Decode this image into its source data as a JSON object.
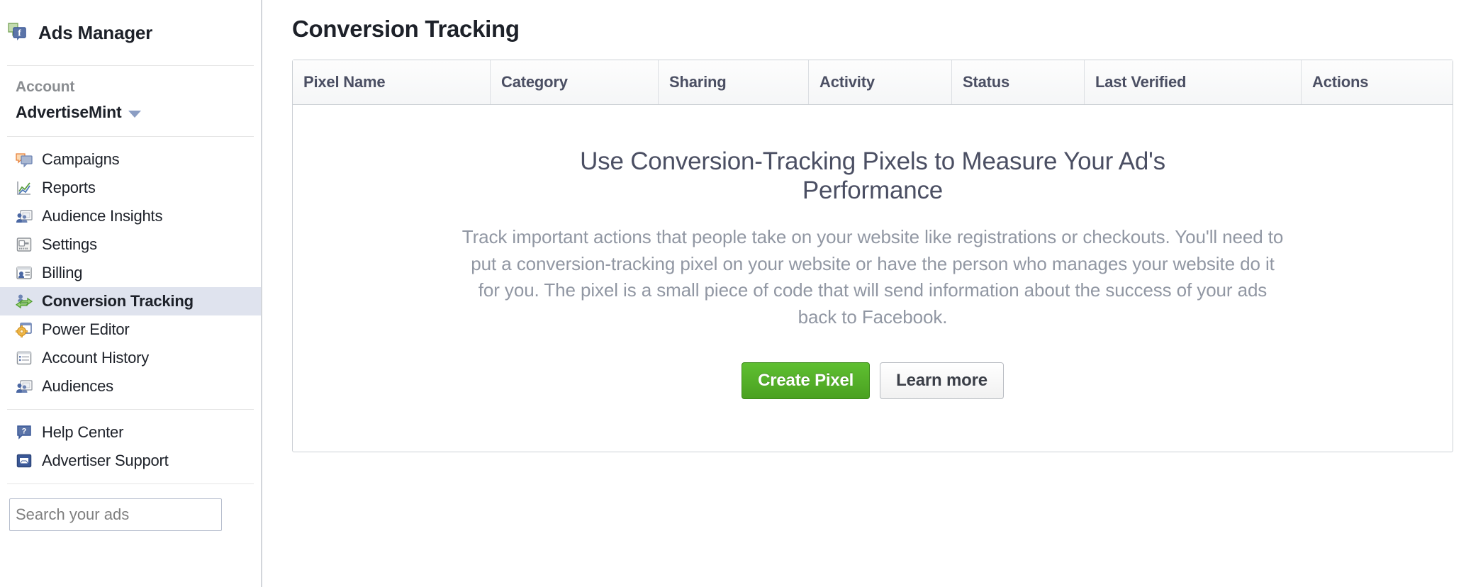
{
  "sidebar": {
    "brand": {
      "label": "Ads Manager",
      "icon": "facebook-ads-manager-icon"
    },
    "account": {
      "heading": "Account",
      "name": "AdvertiseMint",
      "caret_icon": "chevron-down-icon"
    },
    "nav_primary": [
      {
        "label": "Campaigns",
        "icon": "speech-bubbles-icon",
        "selected": false
      },
      {
        "label": "Reports",
        "icon": "line-chart-icon",
        "selected": false
      },
      {
        "label": "Audience Insights",
        "icon": "people-screen-icon",
        "selected": false
      },
      {
        "label": "Settings",
        "icon": "settings-panel-icon",
        "selected": false
      },
      {
        "label": "Billing",
        "icon": "billing-card-icon",
        "selected": false
      },
      {
        "label": "Conversion Tracking",
        "icon": "conversion-arrow-icon",
        "selected": true
      },
      {
        "label": "Power Editor",
        "icon": "gear-window-icon",
        "selected": false
      },
      {
        "label": "Account History",
        "icon": "list-window-icon",
        "selected": false
      },
      {
        "label": "Audiences",
        "icon": "people-screen-icon",
        "selected": false
      }
    ],
    "nav_support": [
      {
        "label": "Help Center",
        "icon": "question-bubble-icon"
      },
      {
        "label": "Advertiser Support",
        "icon": "inbox-icon"
      }
    ],
    "search": {
      "placeholder": "Search your ads",
      "value": ""
    }
  },
  "main": {
    "page_title": "Conversion Tracking",
    "table": {
      "columns": [
        "Pixel Name",
        "Category",
        "Sharing",
        "Activity",
        "Status",
        "Last Verified",
        "Actions"
      ]
    },
    "empty_state": {
      "title": "Use Conversion-Tracking Pixels to Measure Your Ad's Performance",
      "body": "Track important actions that people take on your website like registrations or checkouts. You'll need to put a conversion-tracking pixel on your website or have the person who manages your website do it for you. The pixel is a small piece of code that will send information about the success of your ads back to Facebook.",
      "primary_button": "Create Pixel",
      "secondary_button": "Learn more"
    }
  },
  "colors": {
    "primary_button_green": "#5fbf31",
    "selected_row_blue": "#dfe3ee",
    "text_dark": "#1d2129",
    "text_muted": "#9197a3",
    "header_text": "#4b4f63",
    "border": "#ccd0d5"
  }
}
